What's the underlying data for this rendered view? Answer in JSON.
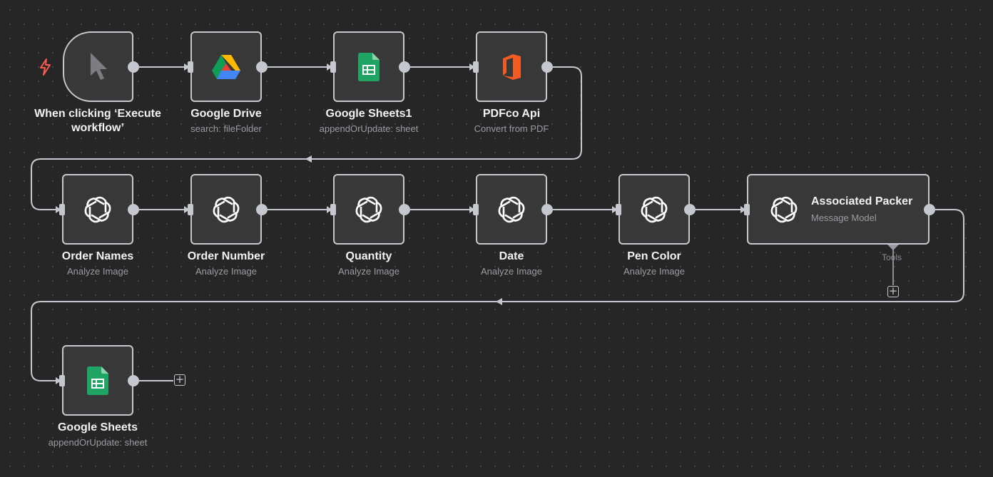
{
  "colors": {
    "canvas": "#262626",
    "node_bg": "#383838",
    "node_border": "#c6c8cf",
    "edge": "#c6c8cf",
    "trigger_bolt": "#ff5a4f"
  },
  "nodes": [
    {
      "id": "trigger",
      "title": "When clicking ‘Execute workflow’",
      "subtitle": "",
      "icon": "cursor-icon"
    },
    {
      "id": "gdrive",
      "title": "Google Drive",
      "subtitle": "search: fileFolder",
      "icon": "google-drive-icon"
    },
    {
      "id": "gsheets1",
      "title": "Google Sheets1",
      "subtitle": "appendOrUpdate: sheet",
      "icon": "google-sheets-icon"
    },
    {
      "id": "pdfco",
      "title": "PDFco Api",
      "subtitle": "Convert from PDF",
      "icon": "pdfco-icon"
    },
    {
      "id": "order_names",
      "title": "Order Names",
      "subtitle": "Analyze Image",
      "icon": "openai-icon"
    },
    {
      "id": "order_number",
      "title": "Order Number",
      "subtitle": "Analyze Image",
      "icon": "openai-icon"
    },
    {
      "id": "quantity",
      "title": "Quantity",
      "subtitle": "Analyze Image",
      "icon": "openai-icon"
    },
    {
      "id": "date",
      "title": "Date",
      "subtitle": "Analyze Image",
      "icon": "openai-icon"
    },
    {
      "id": "pen_color",
      "title": "Pen Color",
      "subtitle": "Analyze Image",
      "icon": "openai-icon"
    },
    {
      "id": "assoc_packer",
      "title": "Associated Packer",
      "subtitle": "Message Model",
      "icon": "openai-icon",
      "tools_label": "Tools"
    },
    {
      "id": "gsheets",
      "title": "Google Sheets",
      "subtitle": "appendOrUpdate: sheet",
      "icon": "google-sheets-icon"
    }
  ]
}
